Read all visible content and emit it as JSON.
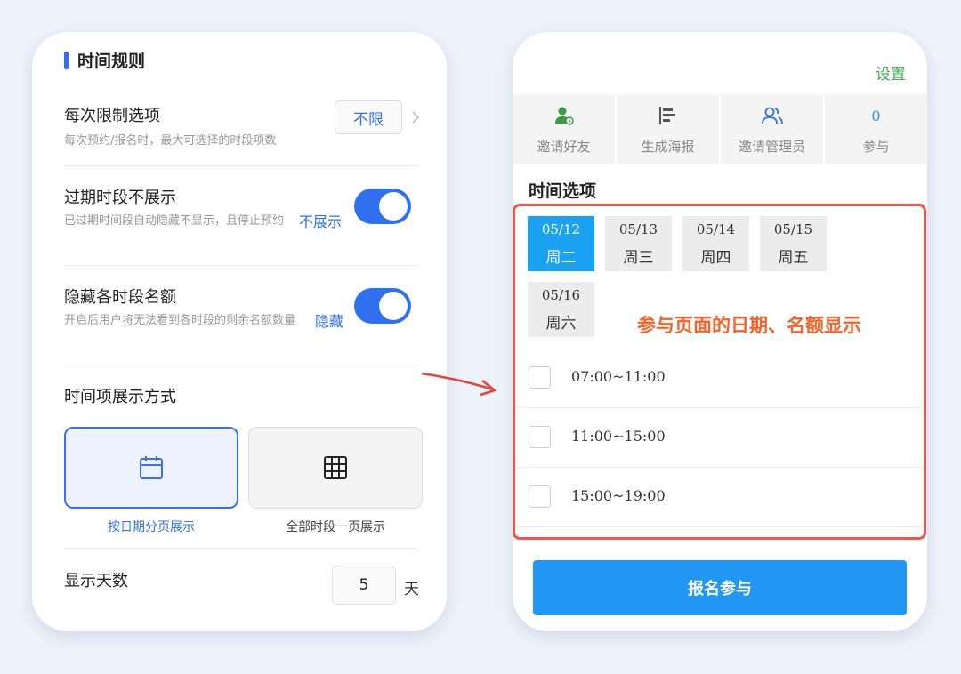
{
  "left": {
    "section_title": "时间规则",
    "limit": {
      "title": "每次限制选项",
      "desc": "每次预约/报名时，最大可选择的时段项数",
      "value": "不限"
    },
    "hide_expired": {
      "title": "过期时段不展示",
      "desc": "已过期时间段自动隐藏不显示，且停止预约",
      "status": "不展示",
      "enabled": true
    },
    "hide_quota": {
      "title": "隐藏各时段名额",
      "desc": "开启后用户将无法看到各时段的剩余名额数量",
      "status": "隐藏",
      "enabled": true
    },
    "display_mode": {
      "title": "时间项展示方式",
      "options": [
        {
          "label": "按日期分页展示",
          "icon": "calendar-icon",
          "selected": true
        },
        {
          "label": "全部时段一页展示",
          "icon": "grid-icon",
          "selected": false
        }
      ]
    },
    "display_days": {
      "title": "显示天数",
      "value": "5",
      "unit": "天"
    }
  },
  "right": {
    "settings_label": "设置",
    "actions": [
      {
        "label": "邀请好友",
        "icon": "invite-friend-icon"
      },
      {
        "label": "生成海报",
        "icon": "poster-icon"
      },
      {
        "label": "邀请管理员",
        "icon": "invite-admin-icon"
      },
      {
        "label": "参与",
        "count": "0"
      }
    ],
    "time_options_title": "时间选项",
    "dates": [
      {
        "date": "05/12",
        "weekday": "周二",
        "active": true
      },
      {
        "date": "05/13",
        "weekday": "周三",
        "active": false
      },
      {
        "date": "05/14",
        "weekday": "周四",
        "active": false
      },
      {
        "date": "05/15",
        "weekday": "周五",
        "active": false
      },
      {
        "date": "05/16",
        "weekday": "周六",
        "active": false
      }
    ],
    "annotation": "参与页面的日期、名额显示",
    "slots": [
      "07:00~11:00",
      "11:00~15:00",
      "15:00~19:00"
    ],
    "signup_button": "报名参与"
  },
  "colors": {
    "accent_blue": "#2f6ff0",
    "tab_active": "#1ba1f2",
    "button_blue": "#2196f3",
    "settings_green": "#3bb14a",
    "annotation_orange": "#f5622a",
    "highlight_red": "#f0544f"
  }
}
